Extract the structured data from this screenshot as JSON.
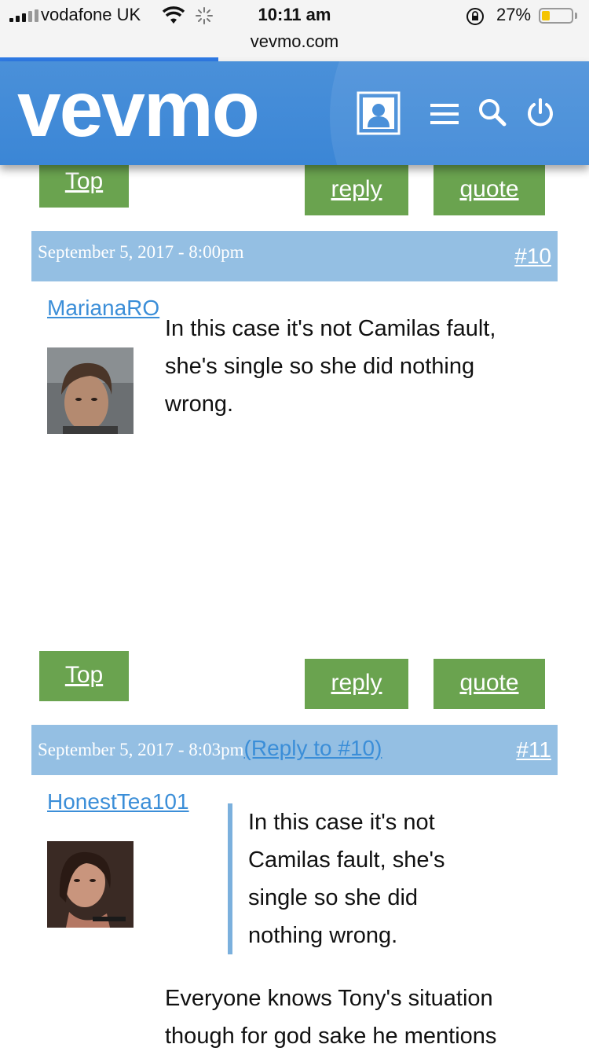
{
  "status_bar": {
    "carrier": "vodafone UK",
    "time": "10:11 am",
    "url": "vevmo.com",
    "battery_percent": "27%",
    "battery_level": 0.27,
    "page_load_progress": 0.37
  },
  "header": {
    "logo": "vevmo",
    "icons": [
      "profile-icon",
      "menu-icon",
      "search-icon",
      "power-icon"
    ]
  },
  "buttons": {
    "top": "Top",
    "reply": "reply",
    "quote": "quote"
  },
  "posts": [
    {
      "date": "September 5, 2017 - 8:00pm",
      "number": "#10",
      "username": "MarianaRO",
      "lines": [
        "In this case it's not Camilas fault,",
        "she's single so she did nothing",
        "wrong."
      ]
    },
    {
      "date": "September 5, 2017 - 8:03pm",
      "reply_to": "(Reply to #10)",
      "number": "#11",
      "username": "HonestTea101",
      "quote_lines": [
        "In this case it's not",
        "Camilas fault, she's",
        "single so she did",
        "nothing wrong."
      ],
      "lines": [
        "Everyone knows Tony's situation",
        "though for god sake he mentions"
      ]
    }
  ],
  "colors": {
    "header_blue": "#4a90d9",
    "button_green": "#6aa34f",
    "post_header_blue": "#94bfe3",
    "link_blue": "#3b8ed8",
    "battery_yellow": "#f5c400"
  }
}
